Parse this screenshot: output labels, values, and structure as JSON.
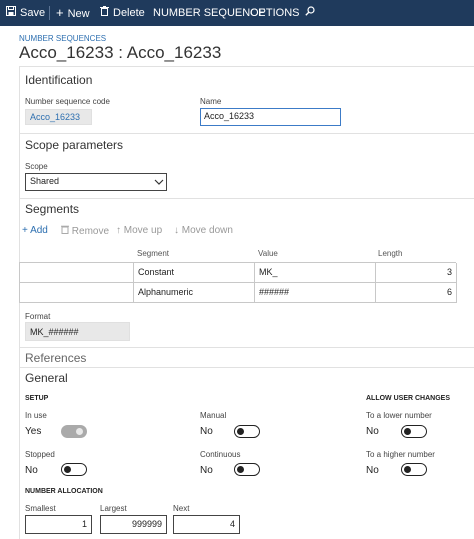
{
  "toolbar": {
    "save": "Save",
    "new": "New",
    "delete": "Delete",
    "number_sequence": "NUMBER SEQUENCE",
    "options": "OPTIONS"
  },
  "page": {
    "breadcrumb": "NUMBER SEQUENCES",
    "title": "Acco_16233 : Acco_16233"
  },
  "identification": {
    "title": "Identification",
    "code_label": "Number sequence code",
    "code_value": "Acco_16233",
    "name_label": "Name",
    "name_value": "Acco_16233"
  },
  "scope": {
    "title": "Scope parameters",
    "scope_label": "Scope",
    "scope_value": "Shared"
  },
  "segments": {
    "title": "Segments",
    "actions": {
      "add": "Add",
      "remove": "Remove",
      "move_up": "Move up",
      "move_down": "Move down"
    },
    "columns": [
      "Segment",
      "Value",
      "Length"
    ],
    "rows": [
      {
        "segment": "Constant",
        "value": "MK_",
        "length": "3"
      },
      {
        "segment": "Alphanumeric",
        "value": "######",
        "length": "6"
      }
    ],
    "format_label": "Format",
    "format_value": "MK_######"
  },
  "references": {
    "title": "References"
  },
  "general": {
    "title": "General",
    "setup_header": "SETUP",
    "allow_header": "ALLOW USER CHANGES",
    "in_use_label": "In use",
    "in_use_value": "Yes",
    "manual_label": "Manual",
    "manual_value": "No",
    "lower_label": "To a lower number",
    "lower_value": "No",
    "stopped_label": "Stopped",
    "stopped_value": "No",
    "continuous_label": "Continuous",
    "continuous_value": "No",
    "higher_label": "To a higher number",
    "higher_value": "No",
    "allocation_header": "NUMBER ALLOCATION",
    "smallest_label": "Smallest",
    "smallest_value": "1",
    "largest_label": "Largest",
    "largest_value": "999999",
    "next_label": "Next",
    "next_value": "4"
  },
  "colors": {
    "toolbar_bg": "#1f3a5c",
    "accent": "#2d6fb0"
  }
}
